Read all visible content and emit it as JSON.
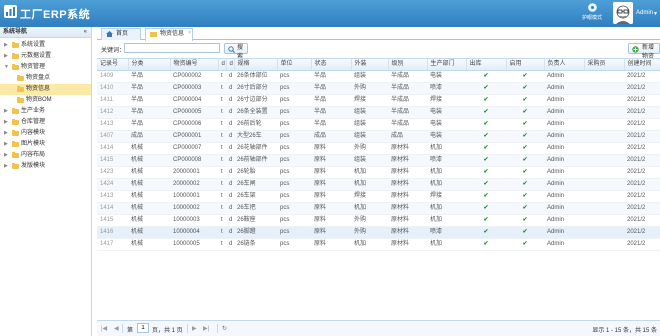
{
  "header": {
    "title": "工厂ERP系统",
    "skin_label": "护眼模式",
    "user_name": "Admin",
    "user_caret": "▼"
  },
  "sidebar": {
    "title": "系统导航",
    "collapse_glyph": "«",
    "items": [
      {
        "label": "系统设置",
        "expanded": false
      },
      {
        "label": "元数据设置",
        "expanded": false
      },
      {
        "label": "物资管理",
        "expanded": true
      },
      {
        "label": "物资盘点",
        "child": true
      },
      {
        "label": "物资信息",
        "child": true,
        "selected": true
      },
      {
        "label": "物资BOM",
        "child": true
      },
      {
        "label": "生产业务",
        "expanded": false
      },
      {
        "label": "仓库管理",
        "expanded": false
      },
      {
        "label": "内容模块",
        "expanded": false
      },
      {
        "label": "图片模块",
        "expanded": false
      },
      {
        "label": "内容布局",
        "expanded": false
      },
      {
        "label": "发版模块",
        "expanded": false
      }
    ]
  },
  "tabs": {
    "home": "首页",
    "active": "物资信息",
    "close_glyph": "×"
  },
  "toolbar": {
    "keyword_label": "关键词：",
    "keyword_value": "",
    "search_label": "搜索",
    "add_label": "新增物资"
  },
  "table": {
    "columns": [
      "记录号",
      "分类",
      "物资编号",
      "d",
      "d",
      "规格",
      "单位",
      "状态",
      "外装",
      "级别",
      "生产部门",
      "出库",
      "启用",
      "负责人",
      "采购员",
      "创建时间"
    ],
    "rows": [
      [
        "1409",
        "半品",
        "CP000002",
        "t",
        "d",
        "26条体部位",
        "pcs",
        "半品",
        "组装",
        "半成品",
        "电装",
        "✔",
        "✔",
        "Admin",
        "",
        "2021/2"
      ],
      [
        "1410",
        "半品",
        "CP000003",
        "t",
        "d",
        "26寸后部分",
        "pcs",
        "半品",
        "外购",
        "半成品",
        "喷漆",
        "✔",
        "✔",
        "Admin",
        "",
        "2021/2"
      ],
      [
        "1411",
        "半品",
        "CP000004",
        "t",
        "d",
        "26寸边部分",
        "pcs",
        "半品",
        "焊接",
        "半成品",
        "焊接",
        "✔",
        "✔",
        "Admin",
        "",
        "2021/2"
      ],
      [
        "1412",
        "半品",
        "CP000005",
        "t",
        "d",
        "26条全装置",
        "pcs",
        "半品",
        "组装",
        "半成品",
        "电装",
        "✔",
        "✔",
        "Admin",
        "",
        "2021/2"
      ],
      [
        "1413",
        "半品",
        "CP000006",
        "t",
        "d",
        "26前后轮",
        "pcs",
        "半品",
        "组装",
        "半成品",
        "电装",
        "✔",
        "✔",
        "Admin",
        "",
        "2021/2"
      ],
      [
        "1407",
        "成品",
        "CP000001",
        "t",
        "d",
        "大型26车",
        "pcs",
        "成品",
        "组装",
        "成品",
        "电装",
        "✔",
        "✔",
        "Admin",
        "",
        "2021/2"
      ],
      [
        "1414",
        "机械",
        "CP000007",
        "t",
        "d",
        "26花轴部件",
        "pcs",
        "原料",
        "外购",
        "原材料",
        "机加",
        "✔",
        "✔",
        "Admin",
        "",
        "2021/2"
      ],
      [
        "1415",
        "机械",
        "CP000008",
        "t",
        "d",
        "26前轴部件",
        "pcs",
        "原料",
        "组装",
        "原材料",
        "喷漆",
        "✔",
        "✔",
        "Admin",
        "",
        "2021/2"
      ],
      [
        "1423",
        "机械",
        "20000001",
        "t",
        "d",
        "26轮胎",
        "pcs",
        "原料",
        "机加",
        "原材料",
        "机加",
        "✔",
        "✔",
        "Admin",
        "",
        "2021/2"
      ],
      [
        "1424",
        "机械",
        "20000002",
        "t",
        "d",
        "26车闸",
        "pcs",
        "原料",
        "机加",
        "原材料",
        "机加",
        "✔",
        "✔",
        "Admin",
        "",
        "2021/2"
      ],
      [
        "1413",
        "机械",
        "10000001",
        "t",
        "d",
        "26车架",
        "pcs",
        "原料",
        "焊接",
        "原材料",
        "焊接",
        "✔",
        "✔",
        "Admin",
        "",
        "2021/2"
      ],
      [
        "1414",
        "机械",
        "10000002",
        "t",
        "d",
        "26车把",
        "pcs",
        "原料",
        "机加",
        "原材料",
        "机加",
        "✔",
        "✔",
        "Admin",
        "",
        "2021/2"
      ],
      [
        "1415",
        "机械",
        "10000003",
        "t",
        "d",
        "26鞍座",
        "pcs",
        "原料",
        "外购",
        "原材料",
        "机加",
        "✔",
        "✔",
        "Admin",
        "",
        "2021/2"
      ],
      [
        "1416",
        "机械",
        "10000004",
        "t",
        "d",
        "26脚蹬",
        "pcs",
        "原料",
        "外购",
        "原材料",
        "喷漆",
        "✔",
        "✔",
        "Admin",
        "",
        "2021/2"
      ],
      [
        "1417",
        "机械",
        "10000005",
        "t",
        "d",
        "26链条",
        "pcs",
        "原料",
        "机加",
        "原材料",
        "机加",
        "✔",
        "✔",
        "Admin",
        "",
        "2021/2"
      ]
    ]
  },
  "pager": {
    "first": "|◀",
    "prev": "◀",
    "page_prefix": "第",
    "page_value": "1",
    "page_suffix": "页，共 1 页",
    "next": "▶",
    "last": "▶|",
    "refresh": "↻",
    "info": "显示 1 - 15 条，共 15 条"
  },
  "colors": {
    "header": "#3b8dcc",
    "selected": "#fbe9a8",
    "check": "#2a8d3a"
  }
}
